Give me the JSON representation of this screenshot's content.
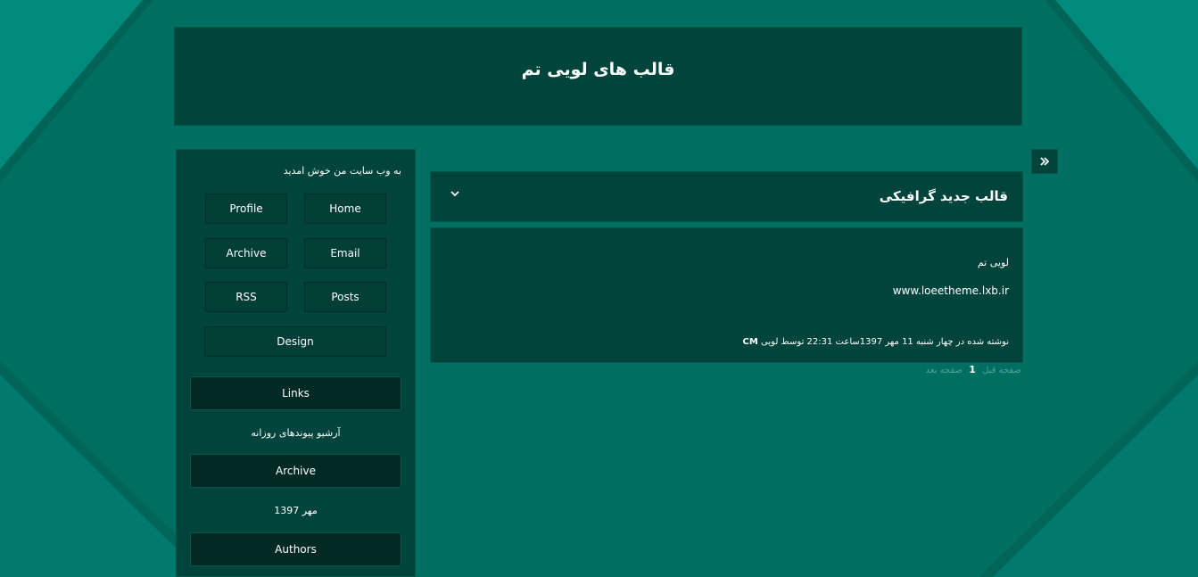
{
  "header": {
    "title": "قالب های لویی تم"
  },
  "sidebar": {
    "welcome": "به وب سایت من خوش امدید",
    "nav": {
      "home": "Home",
      "profile": "Profile",
      "email": "Email",
      "archive": "Archive",
      "posts": "Posts",
      "rss": "RSS",
      "design": "Design"
    },
    "links_title": "Links",
    "daily_links": "آرشیو پیوندهای روزانه",
    "archive_title": "Archive",
    "archive_month": "مهر 1397",
    "authors_title": "Authors"
  },
  "post": {
    "title": "قالب جدید گرافیکی",
    "body_text": "لویی تم",
    "url": "www.loeetheme.lxb.ir",
    "meta_text": "نوشته شده در  چهار شنبه 11 مهر 1397ساعت 22:31  توسط لویی",
    "meta_extra": "CM"
  },
  "pager": {
    "prev": "صفحه قبل",
    "current": "1",
    "next": "صفحه بعد"
  },
  "icons": {
    "toggle": "double-chevron-right-icon",
    "post_toggle": "chevron-down-icon"
  },
  "colors": {
    "background": "#006e60",
    "panel": "#00443b",
    "block_title": "#012a24",
    "accent_light": "#00897a"
  }
}
